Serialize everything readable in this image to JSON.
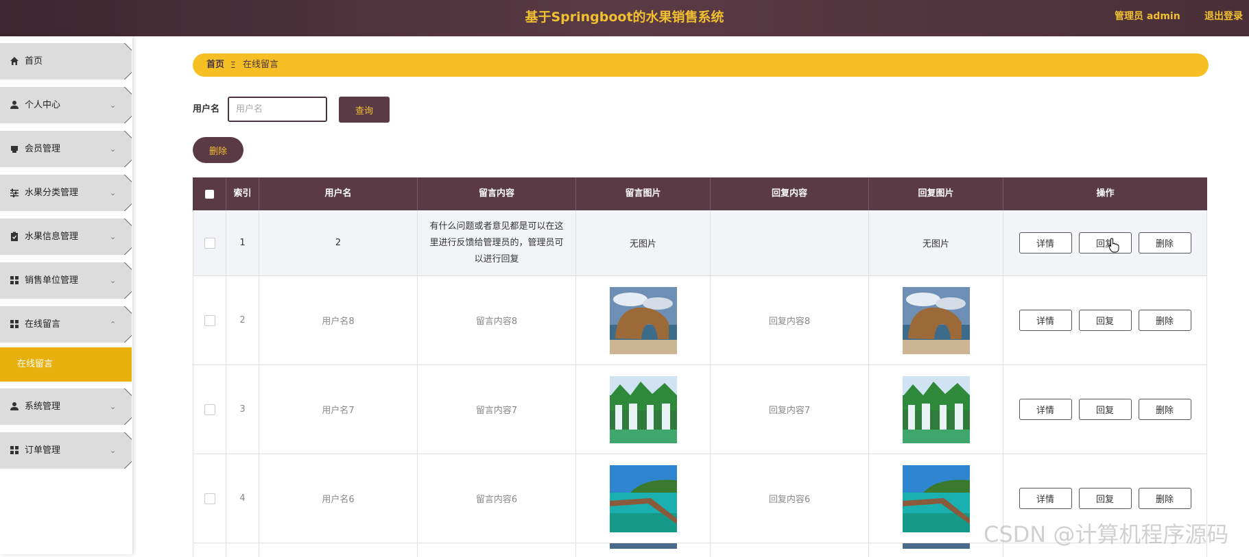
{
  "header": {
    "title": "基于Springboot的水果销售系统",
    "admin": "管理员 admin",
    "logout": "退出登录"
  },
  "sidebar": {
    "items": [
      {
        "label": "首页",
        "icon": "home-icon"
      },
      {
        "label": "个人中心",
        "icon": "user-icon"
      },
      {
        "label": "会员管理",
        "icon": "printer-icon"
      },
      {
        "label": "水果分类管理",
        "icon": "sliders-icon"
      },
      {
        "label": "水果信息管理",
        "icon": "clipboard-icon"
      },
      {
        "label": "销售单位管理",
        "icon": "grid-icon"
      },
      {
        "label": "在线留言",
        "icon": "grid-icon",
        "expanded": true
      },
      {
        "label": "系统管理",
        "icon": "user-icon"
      },
      {
        "label": "订单管理",
        "icon": "grid-icon"
      }
    ],
    "submenu_label": "在线留言"
  },
  "breadcrumb": {
    "home": "首页",
    "separator": "Ξ",
    "current": "在线留言"
  },
  "search": {
    "label": "用户名",
    "placeholder": "用户名",
    "query_button": "查询"
  },
  "delete_button": "删除",
  "table": {
    "headers": [
      "索引",
      "用户名",
      "留言内容",
      "留言图片",
      "回复内容",
      "回复图片",
      "操作"
    ],
    "actions": {
      "detail": "详情",
      "reply": "回复",
      "delete": "删除"
    },
    "rows": [
      {
        "index": "1",
        "username": "2",
        "content": "有什么问题或者意见都是可以在这里进行反馈给管理员的，管理员可以进行回复",
        "image": "无图片",
        "reply": "",
        "reply_image": "无图片"
      },
      {
        "index": "2",
        "username": "用户名8",
        "content": "留言内容8",
        "image": "rock-arch",
        "reply": "回复内容8",
        "reply_image": "rock-arch"
      },
      {
        "index": "3",
        "username": "用户名7",
        "content": "留言内容7",
        "image": "waterfall",
        "reply": "回复内容7",
        "reply_image": "waterfall"
      },
      {
        "index": "4",
        "username": "用户名6",
        "content": "留言内容6",
        "image": "pier",
        "reply": "回复内容6",
        "reply_image": "pier"
      }
    ]
  },
  "watermark": "CSDN @计算机程序源码",
  "colors": {
    "header_bg": "#4a2f38",
    "accent": "#f0c030",
    "button_bg": "#5a3a44",
    "breadcrumb_bg": "#f6c024",
    "submenu_bg": "#e8b00c"
  }
}
